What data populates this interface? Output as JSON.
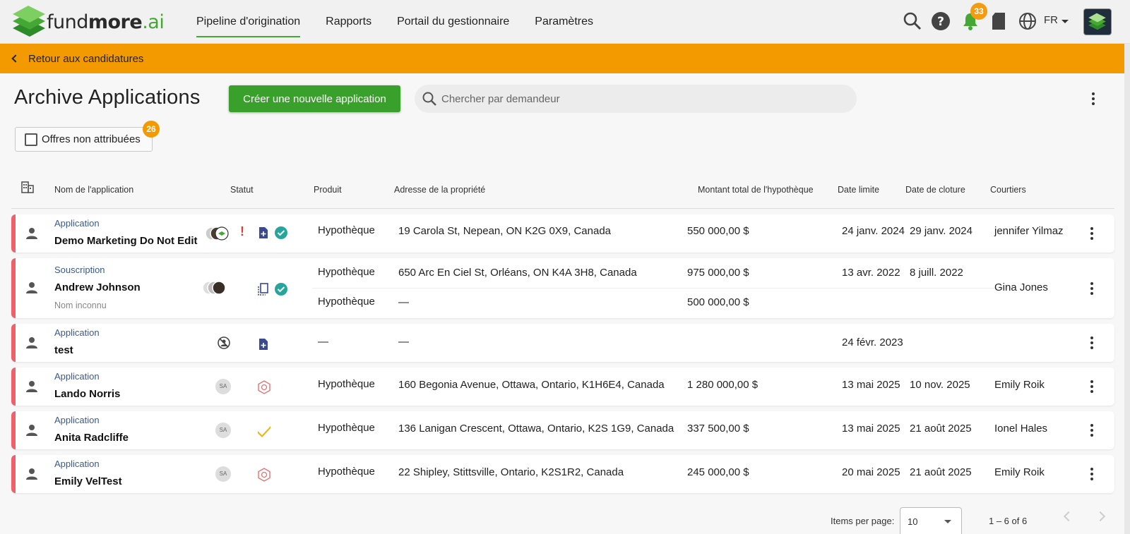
{
  "brand": {
    "part1": "fund",
    "part2": "more",
    "part3": ".ai"
  },
  "nav": {
    "items": [
      {
        "label": "Pipeline d'origination",
        "active": true
      },
      {
        "label": "Rapports",
        "active": false
      },
      {
        "label": "Portail du gestionnaire",
        "active": false
      },
      {
        "label": "Paramètres",
        "active": false
      }
    ],
    "notifications_count": "33",
    "language": "FR"
  },
  "backbar": {
    "label": "Retour aux candidatures"
  },
  "header": {
    "title": "Archive Applications",
    "create_button": "Créer une nouvelle application",
    "search_placeholder": "Chercher par demandeur"
  },
  "filter": {
    "unassigned_label": "Offres non attribuées",
    "unassigned_count": "26"
  },
  "table": {
    "columns": {
      "name": "Nom de l'application",
      "status": "Statut",
      "product": "Produit",
      "address": "Adresse de la propriété",
      "amount": "Montant total de l'hypothèque",
      "deadline": "Date limite",
      "closing": "Date de cloture",
      "brokers": "Courtiers"
    },
    "rows": [
      {
        "type": "Application",
        "name": "Demo Marketing Do Not Edit",
        "product": "Hypothèque",
        "address": "19 Carola St, Nepean, ON K2G 0X9, Canada",
        "amount": "550 000,00 $",
        "deadline": "24 janv. 2024",
        "closing": "29 janv. 2024",
        "broker": "jennifer Yilmaz"
      },
      {
        "type": "Souscription",
        "name": "Andrew Johnson",
        "subname": "Nom inconnu",
        "product": "Hypothèque",
        "address": "650 Arc En Ciel St, Orléans, ON K4A 3H8, Canada",
        "amount": "975 000,00 $",
        "deadline": "13 avr. 2022",
        "closing": "8 juill. 2022",
        "product2": "Hypothèque",
        "address2": "—",
        "amount2": "500 000,00 $",
        "broker": "Gina Jones"
      },
      {
        "type": "Application",
        "name": "test",
        "product": "—",
        "address": "—",
        "deadline": "24 févr. 2023"
      },
      {
        "type": "Application",
        "name": "Lando Norris",
        "initials": "SA",
        "product": "Hypothèque",
        "address": "160 Begonia Avenue, Ottawa, Ontario, K1H6E4, Canada",
        "amount": "1 280 000,00 $",
        "deadline": "13 mai 2025",
        "closing": "10 nov. 2025",
        "broker": "Emily Roik"
      },
      {
        "type": "Application",
        "name": "Anita Radcliffe",
        "initials": "SA",
        "product": "Hypothèque",
        "address": "136 Lanigan Crescent, Ottawa, Ontario, K2S 1G9, Canada",
        "amount": "337 500,00 $",
        "deadline": "13 mai 2025",
        "closing": "21 août 2025",
        "broker": "Ionel Hales"
      },
      {
        "type": "Application",
        "name": "Emily VelTest",
        "initials": "SA",
        "product": "Hypothèque",
        "address": "22 Shipley, Stittsville, Ontario, K2S1R2, Canada",
        "amount": "245 000,00 $",
        "deadline": "20 mai 2025",
        "closing": "21 août 2025",
        "broker": "Emily Roik"
      }
    ]
  },
  "pagination": {
    "items_per_page_label": "Items per page:",
    "page_size": "10",
    "range": "1 – 6 of 6"
  },
  "colors": {
    "brand_green": "#45a834",
    "accent_orange": "#f39a00",
    "row_flag": "#f0606a",
    "create_green": "#3aa02c"
  }
}
